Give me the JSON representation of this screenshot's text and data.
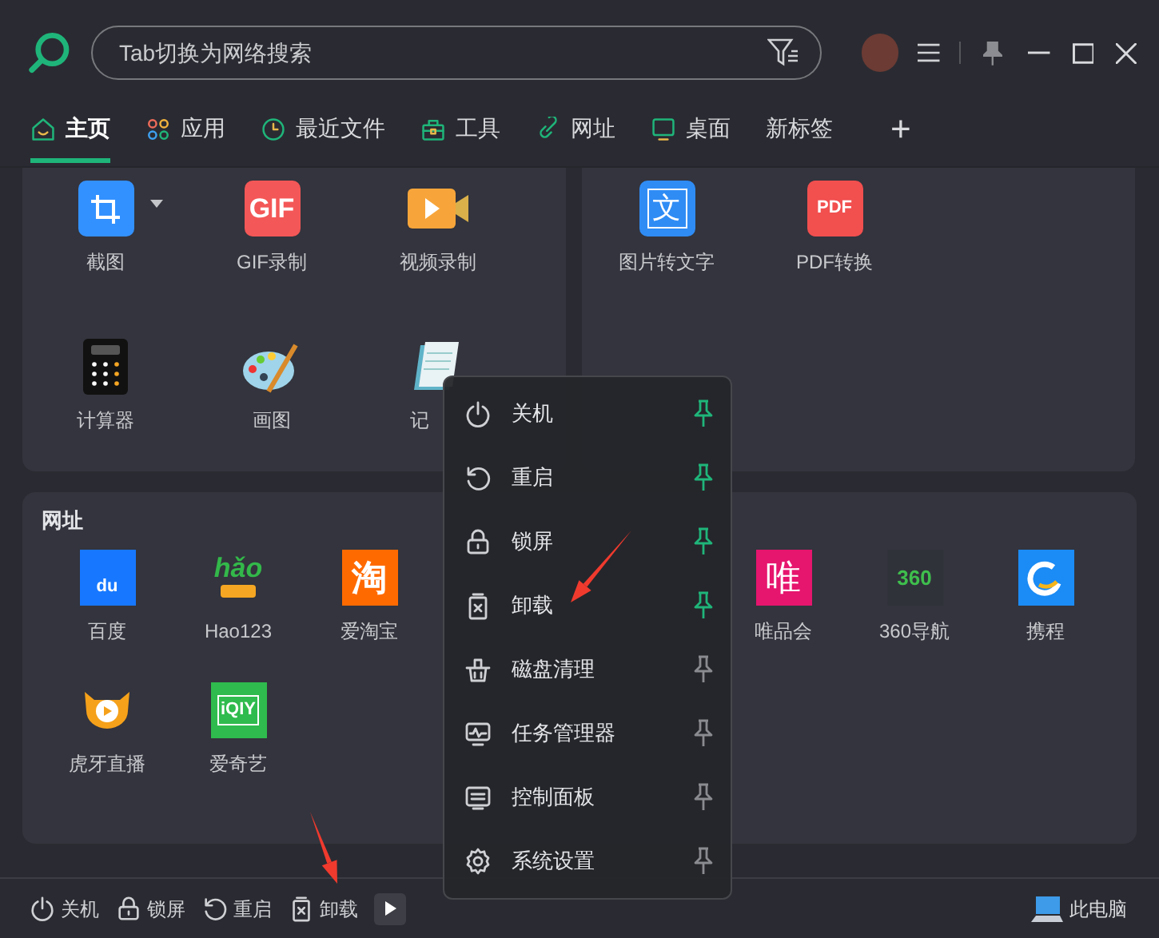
{
  "search": {
    "placeholder": "Tab切换为网络搜索"
  },
  "tabs": [
    {
      "label": "主页",
      "kind": "home",
      "selected": true
    },
    {
      "label": "应用",
      "kind": "apps",
      "selected": false
    },
    {
      "label": "最近文件",
      "kind": "clock",
      "selected": false
    },
    {
      "label": "工具",
      "kind": "toolbox",
      "selected": false
    },
    {
      "label": "网址",
      "kind": "link",
      "selected": false
    },
    {
      "label": "桌面",
      "kind": "monitor",
      "selected": false
    },
    {
      "label": "新标签",
      "kind": "text",
      "selected": false
    },
    {
      "label": "+",
      "kind": "add",
      "selected": false
    }
  ],
  "tools_left": [
    {
      "label": "截图",
      "kind": "crop",
      "dropdown": true
    },
    {
      "label": "GIF录制",
      "kind": "gif",
      "icon_text": "GIF"
    },
    {
      "label": "视频录制",
      "kind": "video"
    },
    {
      "label": "计算器",
      "kind": "calculator"
    },
    {
      "label": "画图",
      "kind": "paint"
    },
    {
      "label": "记",
      "kind": "notepad"
    }
  ],
  "tools_right": [
    {
      "label": "图片转文字",
      "kind": "ocr",
      "icon_text": "文"
    },
    {
      "label": "PDF转换",
      "kind": "pdf",
      "icon_text": "PDF"
    }
  ],
  "web": {
    "title": "网址",
    "row_1_left": [
      {
        "label": "百度",
        "kind": "baidu",
        "icon_text": "du"
      },
      {
        "label": "Hao123",
        "kind": "hao123",
        "icon_text": "hǎo"
      },
      {
        "label": "爱淘宝",
        "kind": "taobao",
        "icon_text": "淘"
      }
    ],
    "row_1_right": [
      {
        "label": "唯品会",
        "kind": "vip",
        "icon_text": "唯"
      },
      {
        "label": "360导航",
        "kind": "nav360",
        "icon_text": "360"
      },
      {
        "label": "携程",
        "kind": "ctrip"
      }
    ],
    "row_2": [
      {
        "label": "虎牙直播",
        "kind": "huya"
      },
      {
        "label": "爱奇艺",
        "kind": "iqiyi",
        "icon_text": "iQIY"
      }
    ]
  },
  "context_menu": [
    {
      "label": "关机",
      "kind": "power",
      "pinned": true
    },
    {
      "label": "重启",
      "kind": "restart",
      "pinned": true
    },
    {
      "label": "锁屏",
      "kind": "lock",
      "pinned": true
    },
    {
      "label": "卸载",
      "kind": "uninstall",
      "pinned": true
    },
    {
      "label": "磁盘清理",
      "kind": "basket",
      "pinned": false
    },
    {
      "label": "任务管理器",
      "kind": "pulse",
      "pinned": false
    },
    {
      "label": "控制面板",
      "kind": "sliders",
      "pinned": false
    },
    {
      "label": "系统设置",
      "kind": "gear",
      "pinned": false
    }
  ],
  "bottom_bar": {
    "actions": [
      {
        "label": "关机",
        "kind": "power"
      },
      {
        "label": "锁屏",
        "kind": "lock"
      },
      {
        "label": "重启",
        "kind": "restart"
      },
      {
        "label": "卸载",
        "kind": "uninstall"
      }
    ],
    "computer": {
      "label": "此电脑"
    }
  }
}
